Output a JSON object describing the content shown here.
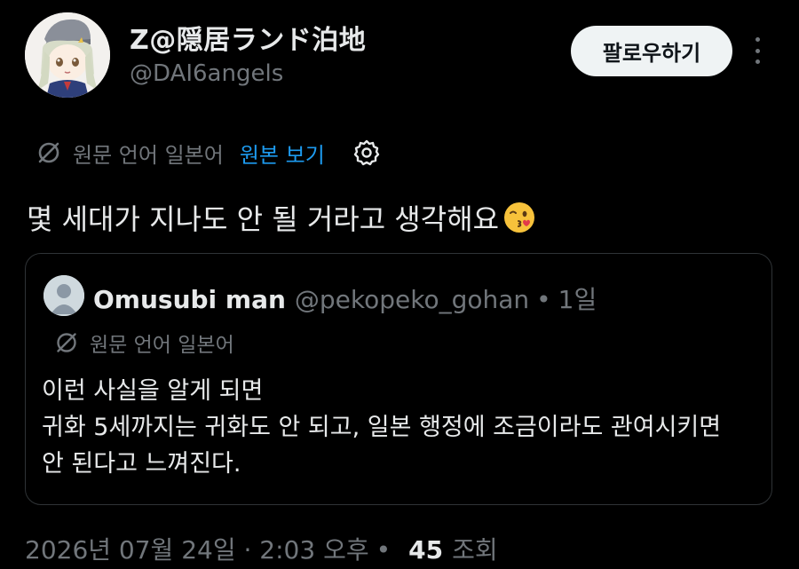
{
  "author": {
    "display_name": "Z@隠居ランド泊地",
    "handle": "@DAI6angels",
    "avatar_icon": "anime-character-avatar"
  },
  "actions": {
    "follow_label": "팔로우하기",
    "more_icon": "more-dots-icon"
  },
  "translation": {
    "source_text": "원문 언어 일본어",
    "show_original_label": "원본 보기",
    "translate_icon": "translate-icon",
    "settings_icon": "gear-icon"
  },
  "tweet": {
    "text": "몇 세대가 지나도 안 될 거라고 생각해요",
    "emoji": "kissing-face-emoji"
  },
  "quote": {
    "display_name": "Omusubi man",
    "handle": "@pekopeko_gohan",
    "separator": "•",
    "time": "1일",
    "translation_text": "원문 언어 일본어",
    "lines": [
      "이런 사실을 알게 되면",
      "귀화 5세까지는 귀화도 안 되고, 일본 행정에 조금이라도 관여시키면",
      "안 된다고 느껴진다."
    ]
  },
  "meta": {
    "timestamp": "2026년 07월 24일 · 2:03 오후",
    "separator": "•",
    "view_count": "45",
    "view_label": "조회"
  },
  "colors": {
    "background": "#000000",
    "primary_text": "#e7e9ea",
    "secondary_text": "#71767b",
    "link": "#1d9bf0",
    "border": "#2f3336"
  }
}
